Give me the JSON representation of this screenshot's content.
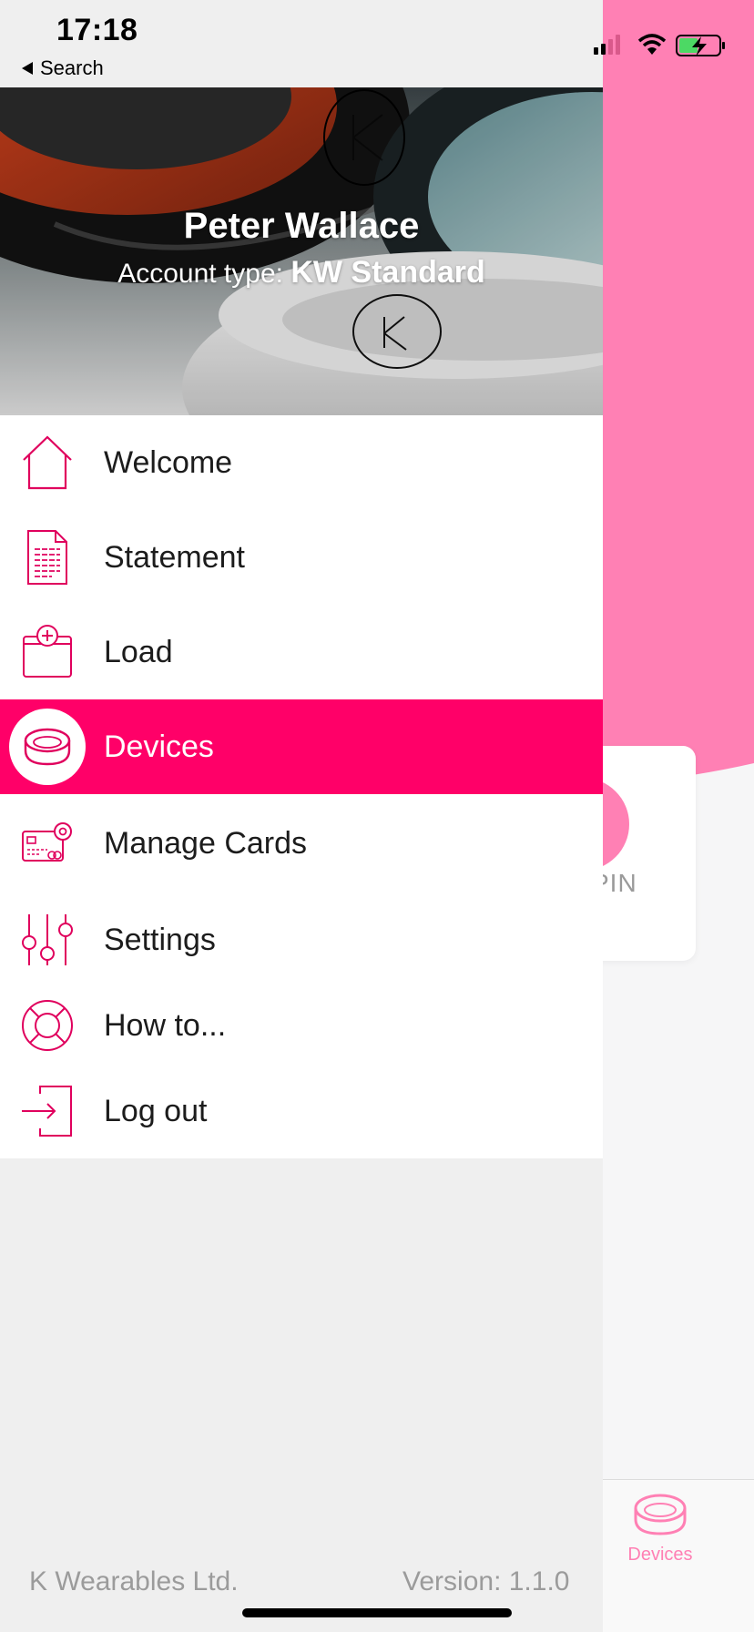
{
  "status_bar": {
    "time": "17:18",
    "back_label": "Search"
  },
  "drawer": {
    "user_name": "Peter Wallace",
    "account_type_label": "Account type:",
    "account_type_value": "KW Standard",
    "menu": [
      {
        "label": "Welcome",
        "icon": "home-icon",
        "active": false
      },
      {
        "label": "Statement",
        "icon": "document-icon",
        "active": false
      },
      {
        "label": "Load",
        "icon": "load-wallet-icon",
        "active": false
      },
      {
        "label": "Devices",
        "icon": "ring-icon",
        "active": true
      },
      {
        "label": "Manage Cards",
        "icon": "card-settings-icon",
        "active": false
      },
      {
        "label": "Settings",
        "icon": "sliders-icon",
        "active": false
      },
      {
        "label": "How to...",
        "icon": "lifebuoy-icon",
        "active": false
      },
      {
        "label": "Log out",
        "icon": "logout-icon",
        "active": false
      }
    ],
    "footer": {
      "company": "K Wearables Ltd.",
      "version": "Version: 1.1.0"
    }
  },
  "background_app": {
    "card_text": "PIN",
    "tab_label": "Devices"
  },
  "colors": {
    "accent": "#ff0068",
    "accent_light": "#ff80b4",
    "muted_text": "#9b9b9b"
  }
}
